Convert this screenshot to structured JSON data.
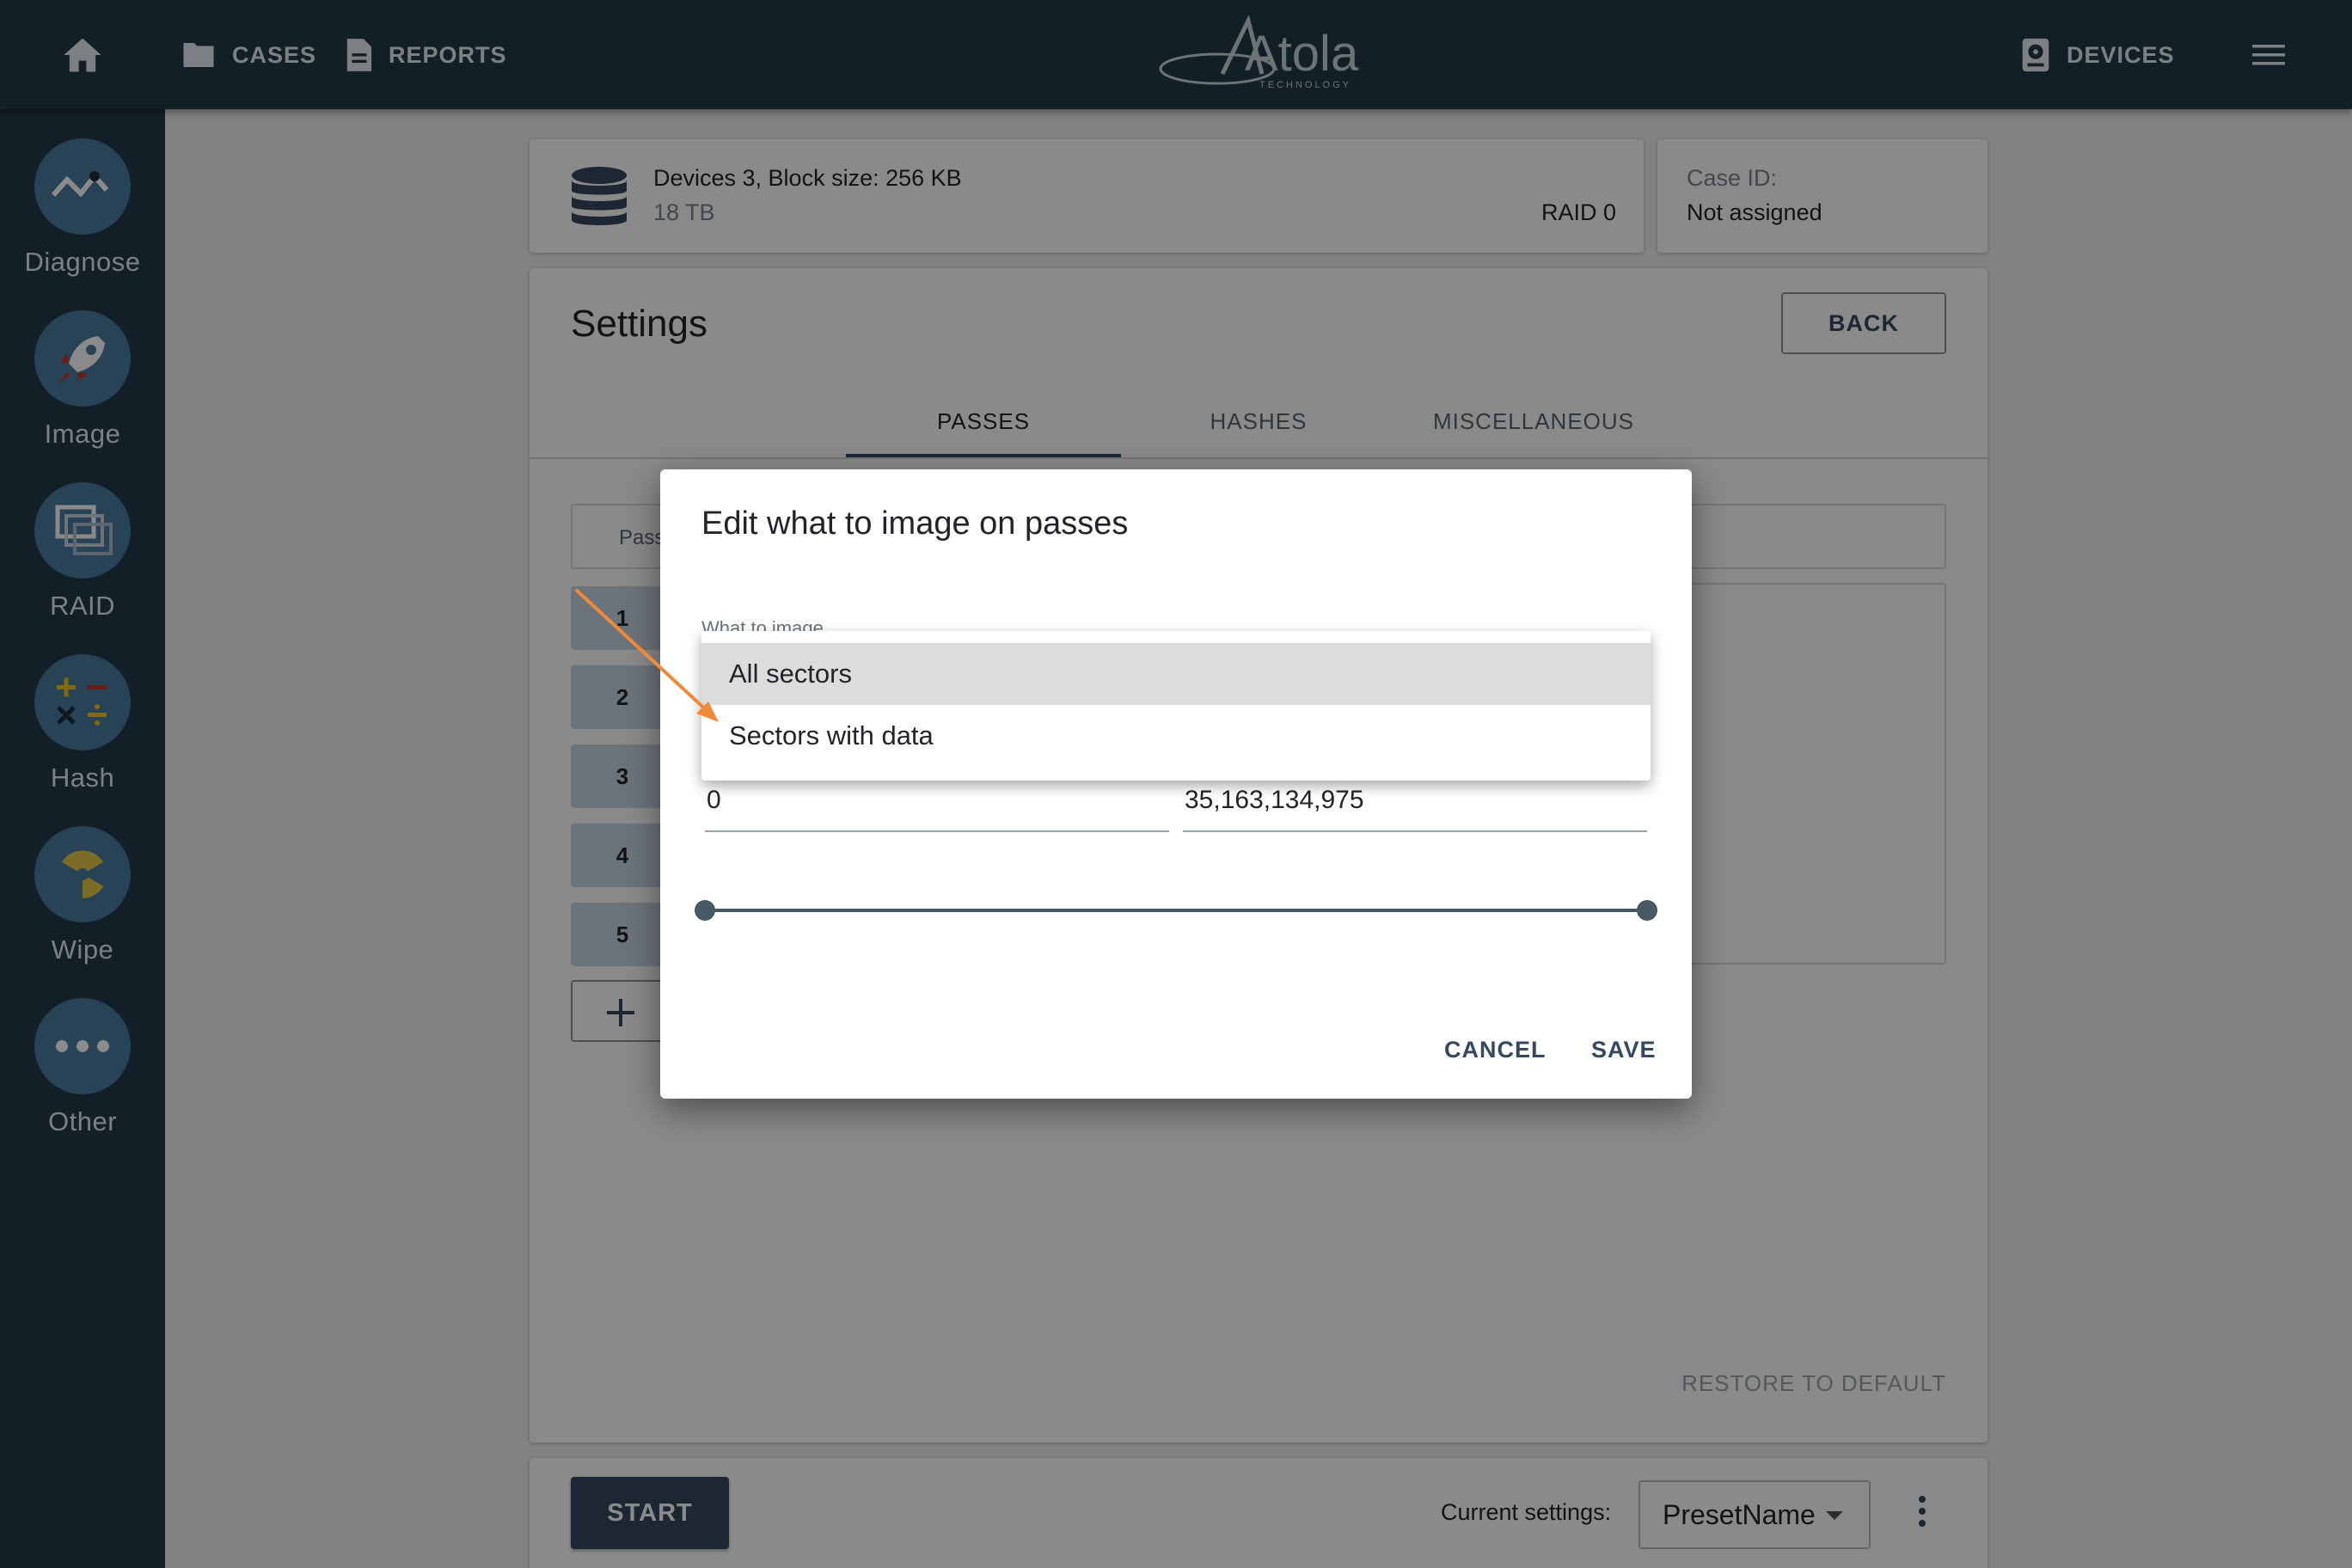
{
  "topbar": {
    "cases_label": "CASES",
    "reports_label": "REPORTS",
    "devices_label": "DEVICES",
    "logo_text": "Atola",
    "logo_subtext": "TECHNOLOGY"
  },
  "sidebar": {
    "items": [
      {
        "label": "Diagnose",
        "icon": "diagnose-icon"
      },
      {
        "label": "Image",
        "icon": "rocket-icon"
      },
      {
        "label": "RAID",
        "icon": "raid-icon"
      },
      {
        "label": "Hash",
        "icon": "hash-icon"
      },
      {
        "label": "Wipe",
        "icon": "radiation-icon"
      },
      {
        "label": "Other",
        "icon": "more-icon"
      }
    ]
  },
  "device": {
    "title": "Devices 3, Block size: 256 KB",
    "size": "18 TB",
    "raid": "RAID 0"
  },
  "case": {
    "label": "Case ID:",
    "value": "Not assigned"
  },
  "settings": {
    "title": "Settings",
    "back_label": "BACK",
    "tabs": [
      "PASSES",
      "HASHES",
      "MISCELLANEOUS"
    ],
    "active_tab": "PASSES",
    "table_header_pass": "Pass",
    "passes": [
      "1",
      "2",
      "3",
      "4",
      "5"
    ],
    "restore_label": "RESTORE TO DEFAULT"
  },
  "bottom": {
    "start_label": "START",
    "current_settings_label": "Current settings:",
    "preset_value": "PresetName"
  },
  "dialog": {
    "title": "Edit what to image on passes",
    "field_label": "What to image",
    "options": [
      "All sectors",
      "Sectors with data"
    ],
    "highlighted_option": "All sectors",
    "range_from": "0",
    "range_to": "35,163,134,975",
    "range_fraction_start": 0,
    "range_fraction_end": 1,
    "cancel_label": "CANCEL",
    "save_label": "SAVE"
  },
  "colors": {
    "topbar": "#223a47",
    "accent": "#34495e",
    "pointer_arrow": "#f08a3a"
  }
}
